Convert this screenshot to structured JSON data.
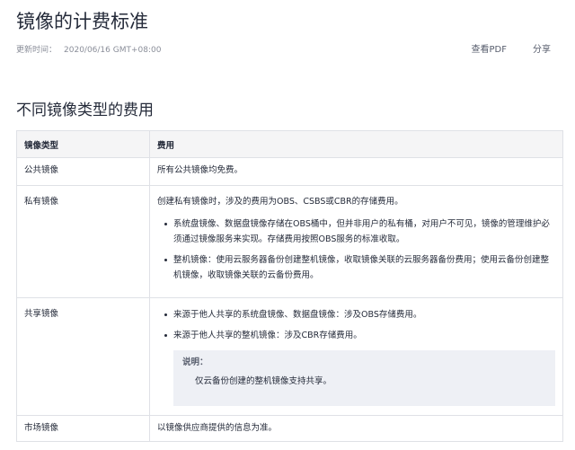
{
  "page": {
    "title": "镜像的计费标准",
    "updated_label": "更新时间：",
    "updated_value": "2020/06/16 GMT+08:00",
    "view_pdf": "查看PDF",
    "share": "分享"
  },
  "section": {
    "title": "不同镜像类型的费用"
  },
  "table": {
    "headers": [
      "镜像类型",
      "费用"
    ],
    "rows": {
      "public": {
        "type": "公共镜像",
        "fee": "所有公共镜像均免费。"
      },
      "private": {
        "type": "私有镜像",
        "fee": "创建私有镜像时，涉及的费用为OBS、CSBS或CBR的存储费用。",
        "bullets": [
          "系统盘镜像、数据盘镜像存储在OBS桶中，但并非用户的私有桶，对用户不可见，镜像的管理维护必须通过镜像服务来实现。存储费用按照OBS服务的标准收取。",
          "整机镜像：使用云服务器备份创建整机镜像，收取镜像关联的云服务器备份费用；使用云备份创建整机镜像，收取镜像关联的云备份费用。"
        ]
      },
      "shared": {
        "type": "共享镜像",
        "bullets": [
          "来源于他人共享的系统盘镜像、数据盘镜像：涉及OBS存储费用。",
          "来源于他人共享的整机镜像：涉及CBR存储费用。"
        ],
        "note_label": "说明：",
        "note_text": "仅云备份创建的整机镜像支持共享。"
      },
      "market": {
        "type": "市场镜像",
        "fee": "以镜像供应商提供的信息为准。"
      }
    }
  }
}
